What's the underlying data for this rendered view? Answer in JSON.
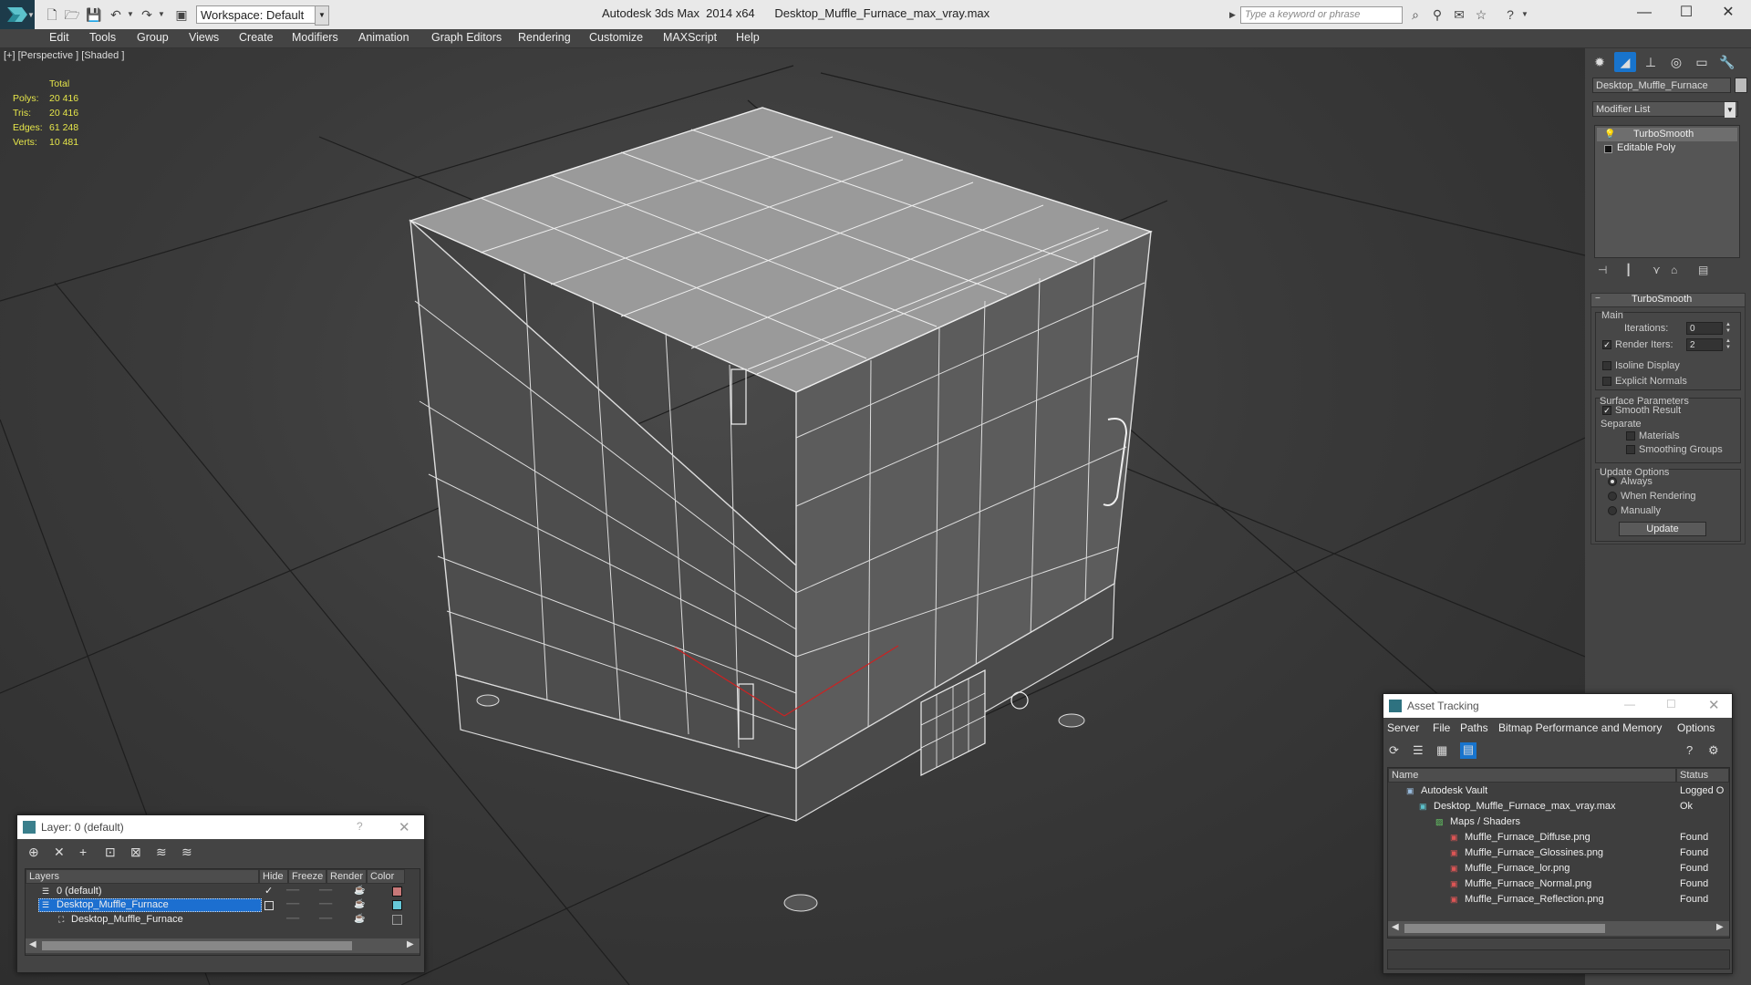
{
  "app": {
    "title": "Autodesk 3ds Max  2014 x64      Desktop_Muffle_Furnace_max_vray.max",
    "workspace": "Workspace: Default",
    "search_placeholder": "Type a keyword or phrase"
  },
  "menu": [
    "Edit",
    "Tools",
    "Group",
    "Views",
    "Create",
    "Modifiers",
    "Animation",
    "Graph Editors",
    "Rendering",
    "Customize",
    "MAXScript",
    "Help"
  ],
  "viewport": {
    "label": "[+] [Perspective ] [Shaded ]",
    "stats_header": "Total",
    "stats": [
      {
        "key": "Polys:",
        "value": "20 416"
      },
      {
        "key": "Tris:",
        "value": "20 416"
      },
      {
        "key": "Edges:",
        "value": "61 248"
      },
      {
        "key": "Verts:",
        "value": "10 481"
      }
    ]
  },
  "command_panel": {
    "object_name": "Desktop_Muffle_Furnace",
    "modifier_list": "Modifier List",
    "stack": [
      "TurboSmooth",
      "Editable Poly"
    ],
    "turbosmooth": {
      "title": "TurboSmooth",
      "main": "Main",
      "iterations_label": "Iterations:",
      "iterations": "0",
      "render_iters_label": "Render Iters:",
      "render_iters": "2",
      "isoline": "Isoline Display",
      "explicit_normals": "Explicit Normals",
      "surface_params": "Surface Parameters",
      "smooth_result": "Smooth Result",
      "separate": "Separate",
      "materials": "Materials",
      "smoothing_groups": "Smoothing Groups",
      "update_options": "Update Options",
      "always": "Always",
      "when_rendering": "When Rendering",
      "manually": "Manually",
      "update_button": "Update"
    }
  },
  "layer_window": {
    "title": "Layer: 0 (default)",
    "help": "?",
    "columns": [
      "Layers",
      "Hide",
      "Freeze",
      "Render",
      "Color"
    ],
    "rows": [
      {
        "name": "0 (default)",
        "color": "#c87878"
      },
      {
        "name": "Desktop_Muffle_Furnace",
        "color": "#66c8d8"
      },
      {
        "name": "Desktop_Muffle_Furnace",
        "color": "#444444"
      }
    ]
  },
  "asset_window": {
    "title": "Asset Tracking",
    "menu": [
      "Server",
      "File",
      "Paths",
      "Bitmap Performance and Memory",
      "Options"
    ],
    "columns": [
      "Name",
      "Status"
    ],
    "rows": [
      {
        "name": "Autodesk Vault",
        "status": "Logged O"
      },
      {
        "name": "Desktop_Muffle_Furnace_max_vray.max",
        "status": "Ok"
      },
      {
        "name": "Maps / Shaders",
        "status": ""
      },
      {
        "name": "Muffle_Furnace_Diffuse.png",
        "status": "Found"
      },
      {
        "name": "Muffle_Furnace_Glossines.png",
        "status": "Found"
      },
      {
        "name": "Muffle_Furnace_lor.png",
        "status": "Found"
      },
      {
        "name": "Muffle_Furnace_Normal.png",
        "status": "Found"
      },
      {
        "name": "Muffle_Furnace_Reflection.png",
        "status": "Found"
      }
    ]
  },
  "colors": {
    "accent": "#1874cd",
    "stats": "#e6e64a",
    "selection": "#1c6fd0"
  }
}
